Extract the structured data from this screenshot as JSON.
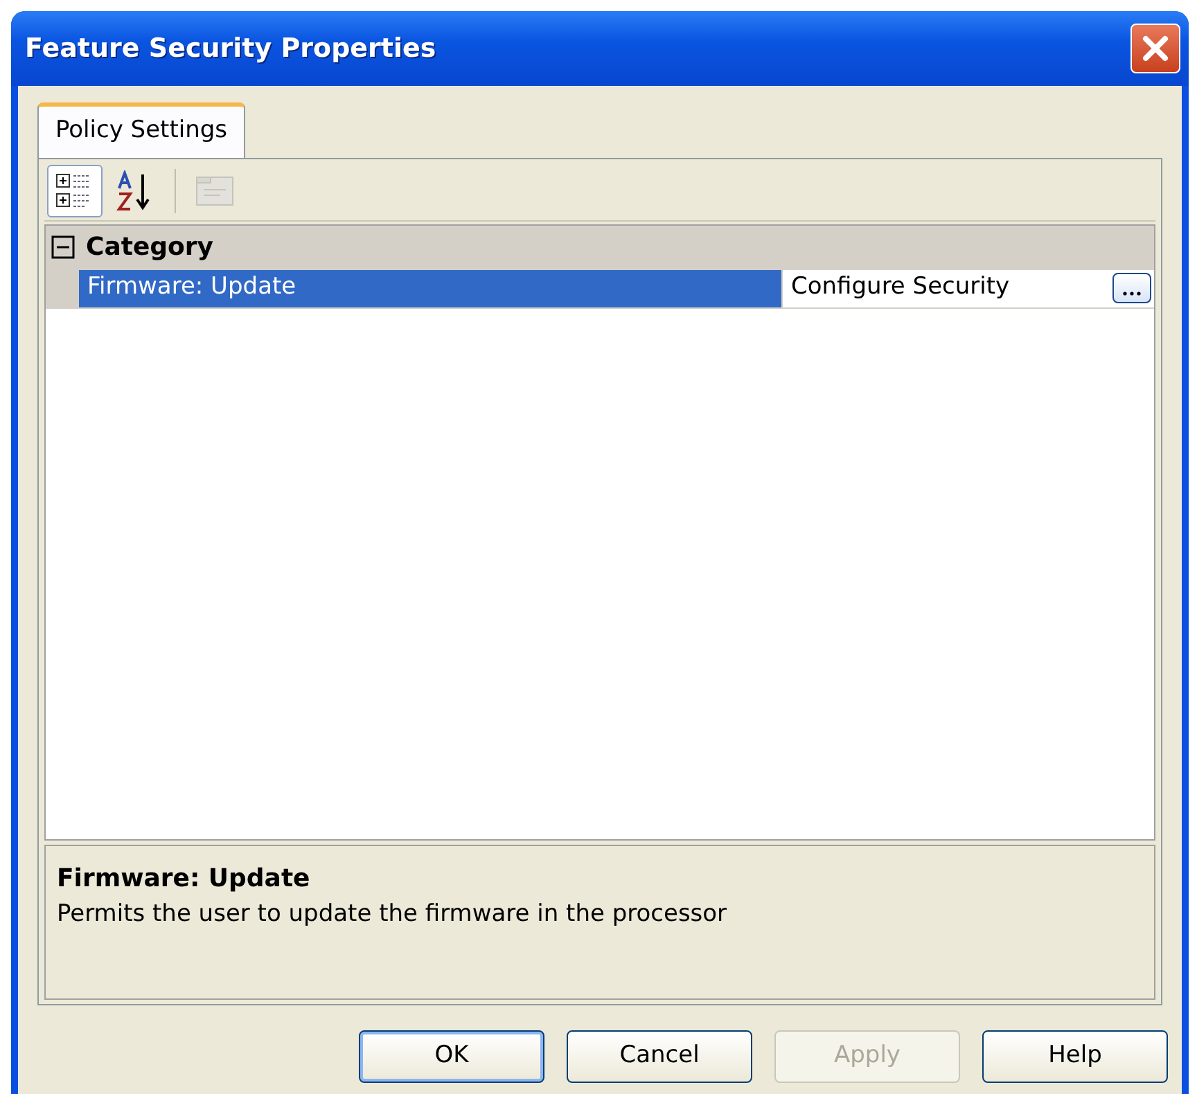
{
  "window": {
    "title": "Feature Security Properties"
  },
  "tabs": [
    {
      "label": "Policy Settings",
      "selected": true
    }
  ],
  "toolbar": [
    {
      "kind": "categorized",
      "selected": true,
      "disabled": false
    },
    {
      "kind": "alphabetical",
      "selected": false,
      "disabled": false
    },
    {
      "kind": "property-pages",
      "selected": false,
      "disabled": true
    }
  ],
  "grid": {
    "categories": [
      {
        "label": "Category",
        "expanded": true,
        "properties": [
          {
            "name": "Firmware: Update",
            "value": "Configure Security",
            "selected": true
          }
        ]
      }
    ]
  },
  "description": {
    "title": "Firmware: Update",
    "text": "Permits the user to update the firmware in the processor"
  },
  "buttons": [
    {
      "label": "OK",
      "default": true,
      "disabled": false
    },
    {
      "label": "Cancel",
      "default": false,
      "disabled": false
    },
    {
      "label": "Apply",
      "default": false,
      "disabled": true
    },
    {
      "label": "Help",
      "default": false,
      "disabled": false
    }
  ]
}
